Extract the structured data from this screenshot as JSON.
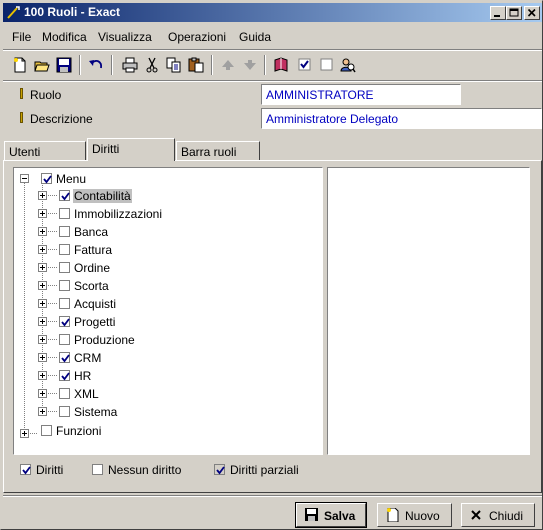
{
  "window": {
    "title": "100 Ruoli - Exact"
  },
  "menu": {
    "items": [
      {
        "label": "File"
      },
      {
        "label": "Modifica"
      },
      {
        "label": "Visualizza"
      },
      {
        "label": "Operazioni"
      },
      {
        "label": "Guida"
      }
    ]
  },
  "toolbar": {
    "buttons": [
      "new-icon",
      "open-icon",
      "save-icon",
      "undo-icon",
      "print-icon",
      "cut-icon",
      "copy-icon",
      "paste-icon",
      "move-up-icon",
      "move-down-icon",
      "book-icon",
      "check-icon",
      "uncheck-icon",
      "user-search-icon"
    ]
  },
  "form": {
    "role_label": "Ruolo",
    "role_value": "AMMINISTRATORE",
    "description_label": "Descrizione",
    "description_value": "Amministratore Delegato"
  },
  "tabs": [
    {
      "label": "Utenti",
      "active": false
    },
    {
      "label": "Diritti",
      "active": true
    },
    {
      "label": "Barra ruoli",
      "active": false
    }
  ],
  "tree": {
    "root": {
      "label": "Menu",
      "checked": true
    },
    "children": [
      {
        "label": "Contabilità",
        "checked": true,
        "selected": true
      },
      {
        "label": "Immobilizzazioni",
        "checked": false
      },
      {
        "label": "Banca",
        "checked": false
      },
      {
        "label": "Fattura",
        "checked": false
      },
      {
        "label": "Ordine",
        "checked": false
      },
      {
        "label": "Scorta",
        "checked": false
      },
      {
        "label": "Acquisti",
        "checked": false
      },
      {
        "label": "Progetti",
        "checked": true
      },
      {
        "label": "Produzione",
        "checked": false
      },
      {
        "label": "CRM",
        "checked": true
      },
      {
        "label": "HR",
        "checked": true
      },
      {
        "label": "XML",
        "checked": false
      },
      {
        "label": "Sistema",
        "checked": false
      }
    ],
    "second_root": {
      "label": "Funzioni",
      "checked": false
    }
  },
  "legend": {
    "rights": "Diritti",
    "no_rights": "Nessun diritto",
    "partial_rights": "Diritti parziali"
  },
  "buttons": {
    "save": "Salva",
    "new": "Nuovo",
    "close": "Chiudi"
  },
  "colors": {
    "titlebar_start": "#0a246a",
    "titlebar_end": "#a6caf0",
    "input_text": "#0000c0",
    "face": "#d4d0c8"
  }
}
